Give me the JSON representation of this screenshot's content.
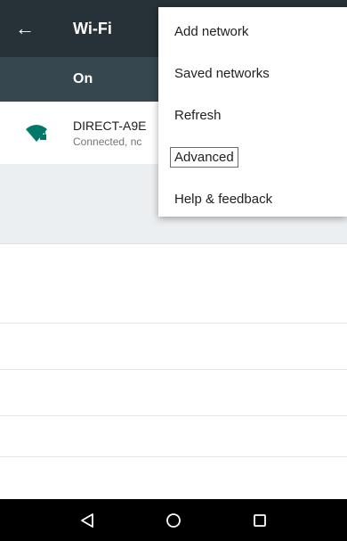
{
  "appbar": {
    "title": "Wi-Fi",
    "back_icon": "arrow-back-icon"
  },
  "toggle": {
    "label": "On"
  },
  "network": {
    "name": "DIRECT-A9E",
    "status": "Connected, nc",
    "icon": "wifi-locked-icon",
    "icon_color": "#00796b"
  },
  "menu": {
    "items": [
      {
        "label": "Add network"
      },
      {
        "label": "Saved networks"
      },
      {
        "label": "Refresh"
      },
      {
        "label": "Advanced"
      },
      {
        "label": "Help & feedback"
      }
    ],
    "highlight_color": "#e53935"
  },
  "navbar": {
    "back": "nav-back-icon",
    "home": "nav-home-icon",
    "recents": "nav-recents-icon"
  },
  "colors": {
    "appbar": "#263238",
    "togglebar": "#37474f",
    "accent": "#00796b"
  }
}
